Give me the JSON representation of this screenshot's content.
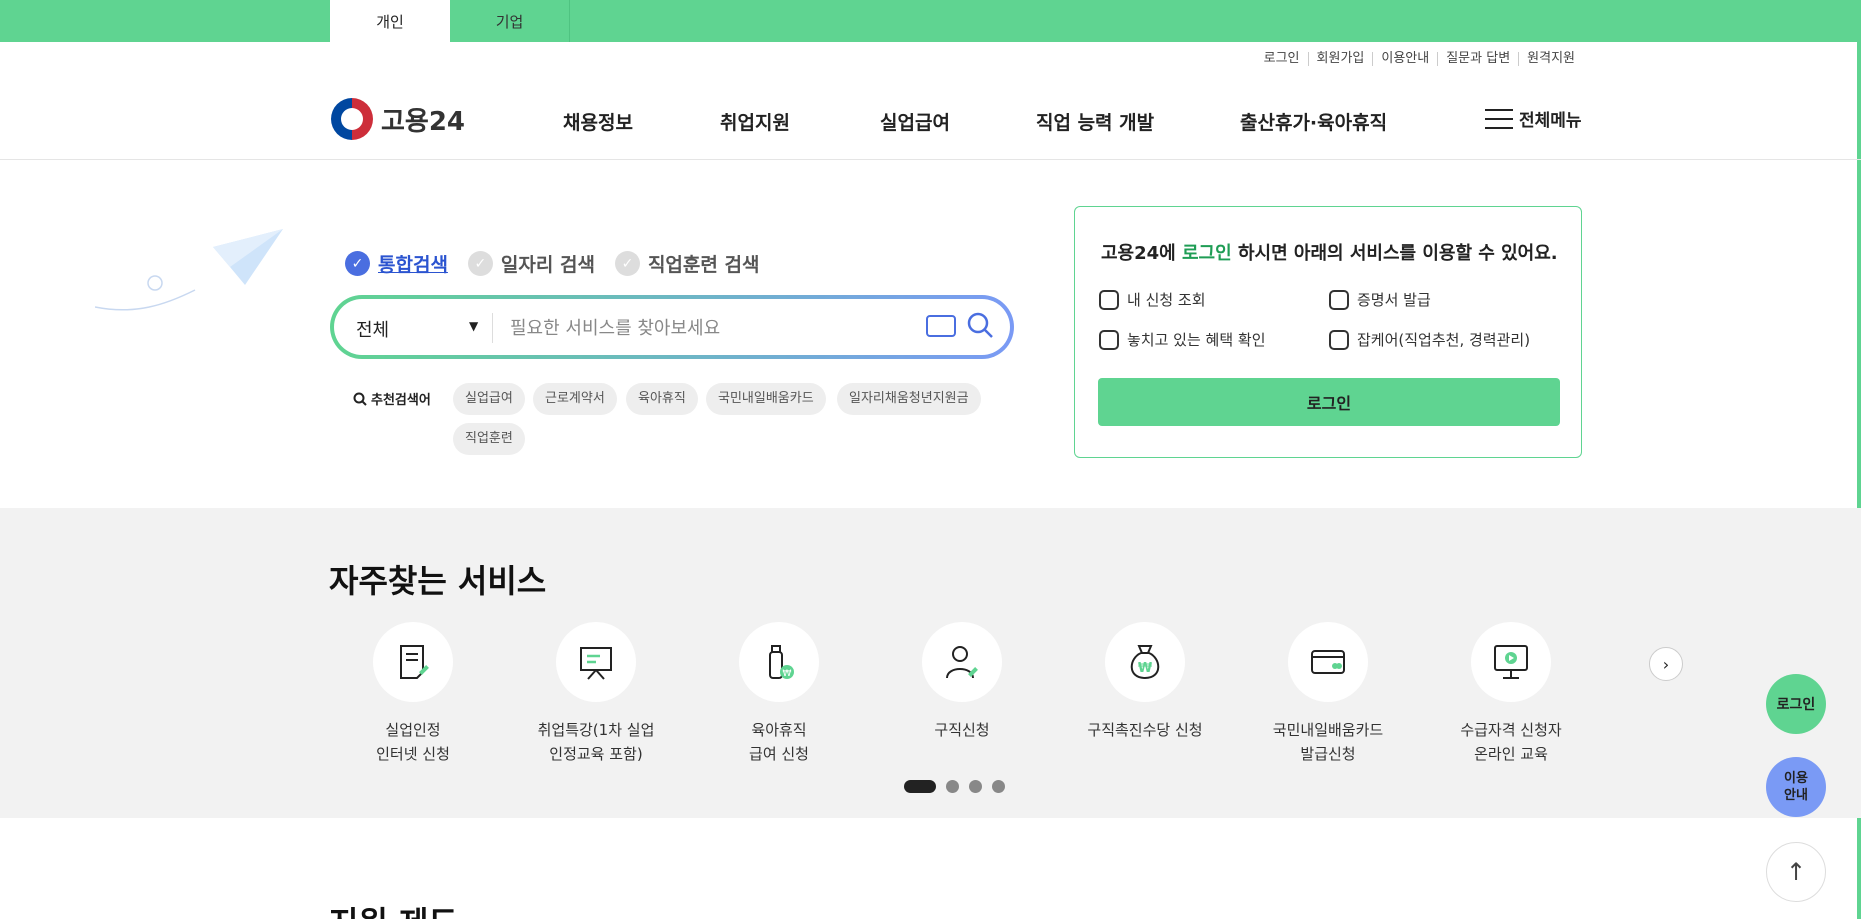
{
  "topbar": {
    "tabs": [
      "개인",
      "기업"
    ]
  },
  "utility": [
    "로그인",
    "회원가입",
    "이용안내",
    "질문과 답변",
    "원격지원"
  ],
  "header": {
    "logo": "고용24",
    "nav": [
      "채용정보",
      "취업지원",
      "실업급여",
      "직업 능력 개발",
      "출산휴가·육아휴직"
    ],
    "all_menu": "전체메뉴"
  },
  "search": {
    "types": [
      "통합검색",
      "일자리 검색",
      "직업훈련 검색"
    ],
    "scope": "전체",
    "placeholder": "필요한 서비스를 찾아보세요",
    "recommend_title": "추천검색어",
    "chips": [
      "실업급여",
      "근로계약서",
      "육아휴직",
      "국민내일배움카드",
      "일자리채움청년지원금",
      "직업훈련"
    ]
  },
  "login_card": {
    "title_pre": "고용24에 ",
    "title_highlight": "로그인",
    "title_post": " 하시면 아래의 서비스를 이용할 수 있어요.",
    "items": [
      "내 신청 조회",
      "증명서 발급",
      "놓치고 있는 혜택 확인",
      "잡케어(직업추천, 경력관리)"
    ],
    "button": "로그인"
  },
  "services": {
    "title": "자주찾는 서비스",
    "items": [
      {
        "line1": "실업인정",
        "line2": "인터넷 신청"
      },
      {
        "line1": "취업특강(1차 실업",
        "line2": "인정교육 포함)"
      },
      {
        "line1": "육아휴직",
        "line2": "급여 신청"
      },
      {
        "line1": "구직신청",
        "line2": ""
      },
      {
        "line1": "구직촉진수당 신청",
        "line2": ""
      },
      {
        "line1": "국민내일배움카드",
        "line2": "발급신청"
      },
      {
        "line1": "수급자격 신청자",
        "line2": "온라인 교육"
      }
    ]
  },
  "support_title": "지원 제도",
  "float": {
    "login": "로그인",
    "guide_1": "이용",
    "guide_2": "안내",
    "top": "↑"
  },
  "colors": {
    "brand_green": "#5fd491",
    "accent_blue": "#4a6ee0"
  }
}
